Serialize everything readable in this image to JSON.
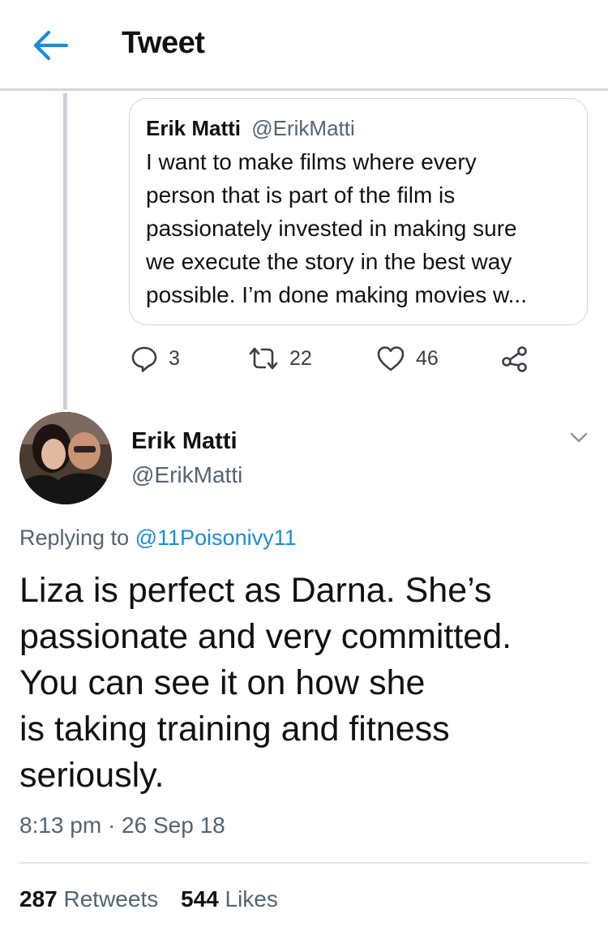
{
  "header": {
    "title": "Tweet",
    "back_icon": "arrow-left-icon"
  },
  "colors": {
    "accent": "#1b8cd8",
    "secondary_text": "#536471",
    "thread_line": "#cdd3d9"
  },
  "quoted_tweet": {
    "author_name": "Erik Matti",
    "author_handle": "@ErikMatti",
    "text_lines": [
      "I want to make films where every",
      "person that is part of the film is",
      "passionately invested in making sure",
      "we execute the story in the best way",
      "possible. I’m done making movies w..."
    ]
  },
  "actions": {
    "reply_count": "3",
    "retweet_count": "22",
    "like_count": "46"
  },
  "tweet": {
    "author_name": "Erik Matti",
    "author_handle": "@ErikMatti",
    "replying_prefix": "Replying to ",
    "replying_to": "@11Poisonivy11",
    "text_lines": [
      "Liza is perfect as Darna. She’s",
      "passionate and very committed.",
      "You can see it on how she",
      "is taking training and fitness",
      "seriously."
    ],
    "timestamp": "8:13 pm · 26 Sep 18"
  },
  "stats": {
    "retweets_count": "287",
    "retweets_label": "Retweets",
    "likes_count": "544",
    "likes_label": "Likes"
  }
}
